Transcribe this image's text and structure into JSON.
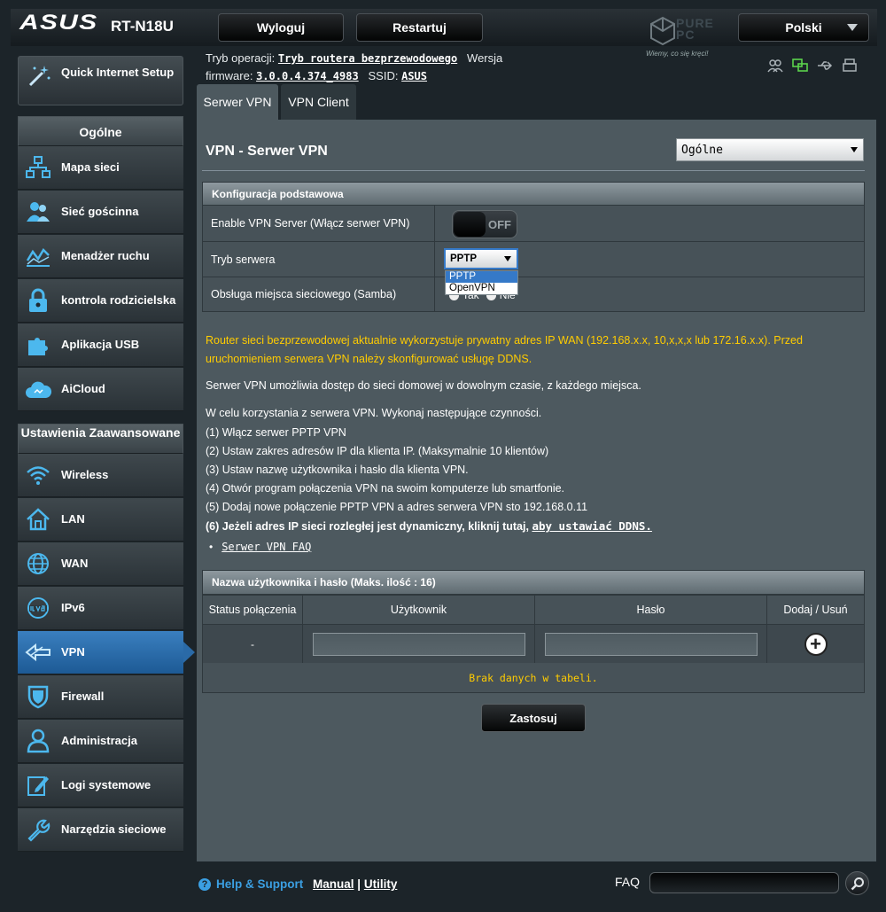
{
  "header": {
    "brand": "ASUS",
    "model": "RT-N18U",
    "logout_label": "Wyloguj",
    "restart_label": "Restartuj",
    "language": "Polski",
    "watermark_brand": "PURE PC",
    "watermark_tagline": "Wiemy, co się kręci!"
  },
  "opinfo": {
    "mode_label": "Tryb operacji:",
    "mode_value": "Tryb routera bezprzewodowego",
    "version_label": "Wersja",
    "firmware_label": "firmware:",
    "firmware_value": "3.0.0.4.374_4983",
    "ssid_label": "SSID:",
    "ssid_value": "ASUS"
  },
  "sidebar": {
    "qis_label": "Quick Internet Setup",
    "general_head": "Ogólne",
    "general_items": [
      "Mapa sieci",
      "Sieć gościnna",
      "Menadżer ruchu",
      "kontrola rodzicielska",
      "Aplikacja USB",
      "AiCloud"
    ],
    "advanced_head": "Ustawienia Zaawansowane",
    "advanced_items": [
      "Wireless",
      "LAN",
      "WAN",
      "IPv6",
      "VPN",
      "Firewall",
      "Administracja",
      "Logi systemowe",
      "Narzędzia sieciowe"
    ],
    "active_item": "VPN"
  },
  "tabs": [
    "Serwer VPN",
    "VPN Client"
  ],
  "page": {
    "title": "VPN - Serwer VPN",
    "view_select": "Ogólne"
  },
  "basic_config": {
    "head": "Konfiguracja podstawowa",
    "enable_label": "Enable VPN Server (Włącz serwer VPN)",
    "toggle_state": "OFF",
    "mode_label": "Tryb serwera",
    "mode_value": "PPTP",
    "mode_options": [
      "PPTP",
      "OpenVPN"
    ],
    "samba_label": "Obsługa miejsca sieciowego (Samba)",
    "samba_yes": "Tak",
    "samba_no": "Nie"
  },
  "notice": "Router sieci bezprzewodowej aktualnie wykorzystuje prywatny adres IP WAN (192.168.x.x, 10,x,x,x lub 172.16.x.x). Przed uruchomieniem serwera VPN należy skonfigurować usługę DDNS.",
  "description": "Serwer VPN umożliwia dostęp do sieci domowej w dowolnym czasie, z każdego miejsca.",
  "steps_intro": "W celu korzystania z serwera VPN. Wykonaj następujące czynności.",
  "steps": [
    "(1) Włącz serwer PPTP VPN",
    "(2) Ustaw zakres adresów IP dla klienta IP. (Maksymalnie 10 klientów)",
    "(3) Ustaw nazwę użytkownika i hasło dla klienta VPN.",
    "(4) Otwór program połączenia VPN na swoim komputerze lub smartfonie.",
    "(5) Dodaj nowe połączenie PPTP VPN a adres serwera VPN sto 192.168.0.11"
  ],
  "step6_text": "(6) Jeżeli adres IP sieci rozległej jest dynamiczny, kliknij tutaj,",
  "step6_link": "aby ustawiać DDNS.",
  "faq_link": "Serwer VPN FAQ",
  "users_table": {
    "head": "Nazwa użytkownika i hasło (Maks. ilość : 16)",
    "columns": [
      "Status połączenia",
      "Użytkownik",
      "Hasło",
      "Dodaj / Usuń"
    ],
    "status_value": "-",
    "empty_message": "Brak danych w tabeli."
  },
  "apply_label": "Zastosuj",
  "footer": {
    "help_label": "Help & Support",
    "manual_label": "Manual",
    "separator": "|",
    "utility_label": "Utility",
    "faq_label": "FAQ"
  },
  "colors": {
    "accent": "#3b9fe2",
    "warning": "#ffcc00",
    "panel": "#4d595f",
    "active_nav": "#2a6aa7"
  }
}
